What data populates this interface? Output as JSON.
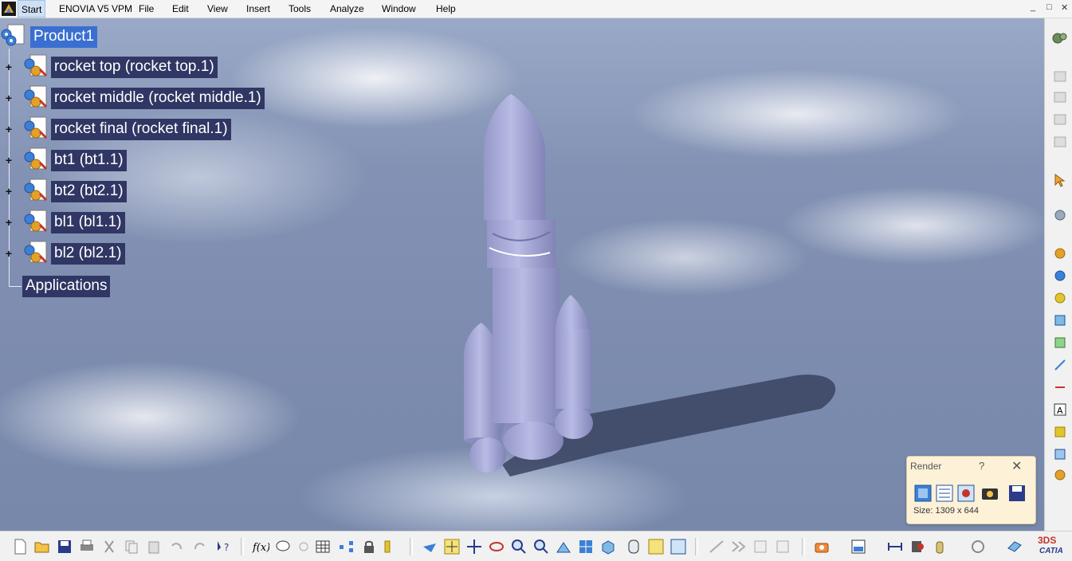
{
  "menubar": {
    "start": "Start",
    "items": [
      "ENOVIA V5 VPM",
      "File",
      "Edit",
      "View",
      "Insert",
      "Tools",
      "Analyze",
      "Window",
      "Help"
    ],
    "window_controls": [
      "_",
      "□",
      "✕"
    ]
  },
  "tree": {
    "root": "Product1",
    "children": [
      "rocket top (rocket top.1)",
      "rocket middle (rocket middle.1)",
      "rocket final (rocket final.1)",
      "bt1 (bt1.1)",
      "bt2 (bt2.1)",
      "bl1 (bl1.1)",
      "bl2 (bl2.1)"
    ],
    "applications": "Applications"
  },
  "render_panel": {
    "title": "Render",
    "help": "?",
    "close": "✕",
    "size": "Size: 1309 x 644"
  },
  "brand": {
    "logo_text": "CATIA",
    "mark": "3DS"
  },
  "colors": {
    "tree_label_bg": "#303764",
    "tree_selected_bg": "#3a6fd1",
    "rocket": "#a9acd6",
    "render_panel_bg": "#fdf1d7"
  }
}
